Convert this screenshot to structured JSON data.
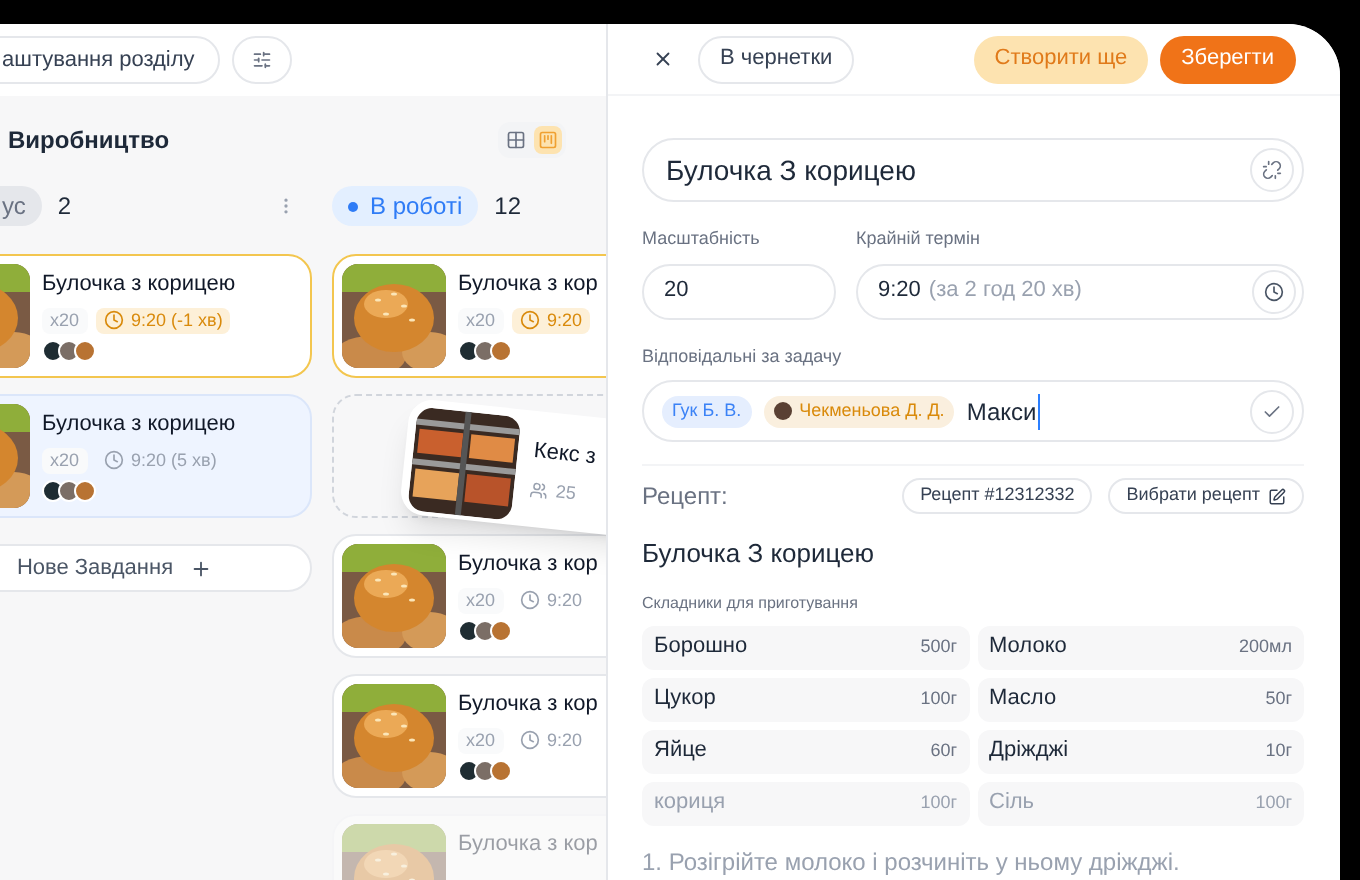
{
  "toolbar": {
    "settings_button": "аштування розділу"
  },
  "board": {
    "title": "Виробництво",
    "views": [
      {
        "kind": "table",
        "selected": false
      },
      {
        "kind": "kanban",
        "selected": true
      }
    ],
    "columns": [
      {
        "kind": "neutral",
        "status": "ус",
        "count": "2",
        "has_menu": true,
        "cards": [
          {
            "kind": "overdue",
            "title": "Булочка з корицею",
            "qty": "x20",
            "time": "9:20 (-1 хв)"
          },
          {
            "kind": "selected",
            "title": "Булочка з корицею",
            "qty": "x20",
            "time": "9:20 (5 хв)"
          }
        ],
        "add_button": "Нове Завдання"
      },
      {
        "kind": "in_progress",
        "status": "В роботі",
        "count": "12",
        "cards": [
          {
            "kind": "overdue",
            "title": "Булочка з кор",
            "qty": "x20",
            "time": "9:20"
          },
          {
            "kind": "drop_zone"
          },
          {
            "kind": "normal",
            "title": "Булочка з кор",
            "qty": "x20",
            "time": "9:20"
          },
          {
            "kind": "normal",
            "title": "Булочка з кор",
            "qty": "x20",
            "time": "9:20"
          },
          {
            "kind": "faded",
            "title": "Булочка з кор"
          }
        ]
      }
    ],
    "dragged_card": {
      "title": "Кекс з",
      "count": "25"
    }
  },
  "panel": {
    "draft_button": "В чернетки",
    "create_more_button": "Створити ще",
    "save_button": "Зберегти",
    "title_value": "Булочка З корицею",
    "scale": {
      "label": "Масштабність",
      "value": "20"
    },
    "deadline": {
      "label": "Крайній термін",
      "value": "9:20",
      "hint": "(за 2 год 20 хв)"
    },
    "assignees": {
      "label": "Відповідальні за задачу",
      "tags": [
        {
          "name": "Гук Б. В.",
          "color": "#3b82f6",
          "avatar": false
        },
        {
          "name": "Чекменьова Д. Д.",
          "color": "#d98a0b",
          "avatar": true
        }
      ],
      "input": "Макси"
    },
    "recipe": {
      "label": "Рецепт:",
      "id_button": "Рецепт #12312332",
      "choose_button": "Вибрати рецепт",
      "title": "Булочка З корицею",
      "subtitle": "Складники для приготування",
      "ingredients": [
        {
          "name": "Борошно",
          "amount": "500г",
          "faded": false
        },
        {
          "name": "Молоко",
          "amount": "200мл",
          "faded": false
        },
        {
          "name": "Цукор",
          "amount": "100г",
          "faded": false
        },
        {
          "name": "Масло",
          "amount": "50г",
          "faded": false
        },
        {
          "name": "Яйце",
          "amount": "60г",
          "faded": false
        },
        {
          "name": "Дріжджі",
          "amount": "10г",
          "faded": false
        },
        {
          "name": "кориця",
          "amount": "100г",
          "faded": true
        },
        {
          "name": "Сіль",
          "amount": "100г",
          "faded": true
        }
      ],
      "step": "1. Розігрійте молоко і розчиніть у ньому дріжджі."
    }
  }
}
